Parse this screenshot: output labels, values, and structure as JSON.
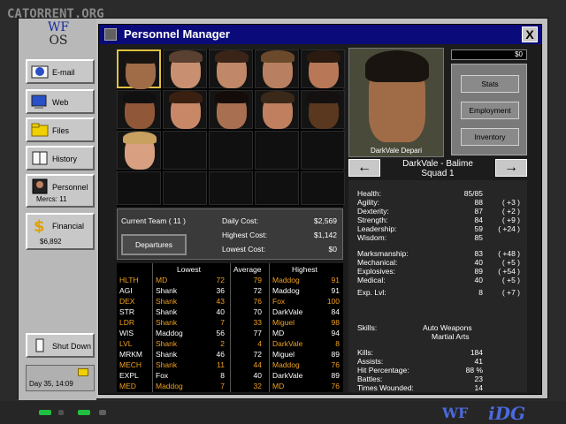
{
  "watermark": "CATORRENT.ORG",
  "os": {
    "logo_wf": "WF",
    "logo_os": "OS",
    "buttons": {
      "email": "E-mail",
      "web": "Web",
      "files": "Files",
      "history": "History",
      "personnel": "Personnel",
      "personnel_sub": "Mercs: 11",
      "financial": "Financial",
      "financial_sub": "$6,892",
      "shutdown": "Shut Down"
    },
    "date": "Day 35, 14:09"
  },
  "window": {
    "title": "Personnel Manager",
    "close": "X"
  },
  "team": {
    "current_team": "Current Team  ( 11 )",
    "daily_cost_label": "Daily Cost:",
    "daily_cost": "$2,569",
    "highest_cost_label": "Highest Cost:",
    "highest_cost": "$1,142",
    "lowest_cost_label": "Lowest Cost:",
    "lowest_cost": "$0",
    "departures": "Departures"
  },
  "stats_table": {
    "headers": {
      "lowest": "Lowest",
      "average": "Average",
      "highest": "Highest"
    },
    "rows": [
      {
        "stat": "HLTH",
        "low_name": "MD",
        "low": "72",
        "avg": "79",
        "high_name": "Maddog",
        "high": "91",
        "highlight": true
      },
      {
        "stat": "AGI",
        "low_name": "Shank",
        "low": "36",
        "avg": "72",
        "high_name": "Maddog",
        "high": "91",
        "highlight": false
      },
      {
        "stat": "DEX",
        "low_name": "Shank",
        "low": "43",
        "avg": "76",
        "high_name": "Fox",
        "high": "100",
        "highlight": true
      },
      {
        "stat": "STR",
        "low_name": "Shank",
        "low": "40",
        "avg": "70",
        "high_name": "DarkVale",
        "high": "84",
        "highlight": false
      },
      {
        "stat": "LDR",
        "low_name": "Shank",
        "low": "7",
        "avg": "33",
        "high_name": "Miguel",
        "high": "98",
        "highlight": true
      },
      {
        "stat": "WIS",
        "low_name": "Maddog",
        "low": "56",
        "avg": "77",
        "high_name": "MD",
        "high": "94",
        "highlight": false
      },
      {
        "stat": "LVL",
        "low_name": "Shank",
        "low": "2",
        "avg": "4",
        "high_name": "DarkVale",
        "high": "8",
        "highlight": true
      },
      {
        "stat": "MRKM",
        "low_name": "Shank",
        "low": "46",
        "avg": "72",
        "high_name": "Miguel",
        "high": "89",
        "highlight": false
      },
      {
        "stat": "MECH",
        "low_name": "Shank",
        "low": "11",
        "avg": "44",
        "high_name": "Maddog",
        "high": "76",
        "highlight": true
      },
      {
        "stat": "EXPL",
        "low_name": "Fox",
        "low": "8",
        "avg": "40",
        "high_name": "DarkVale",
        "high": "89",
        "highlight": false
      },
      {
        "stat": "MED",
        "low_name": "Maddog",
        "low": "7",
        "avg": "32",
        "high_name": "MD",
        "high": "76",
        "highlight": true
      }
    ]
  },
  "merc": {
    "portrait_caption": "DarkVale Depari",
    "title": "DarkVale - Balime",
    "squad": "Squad 1",
    "cash": "$0",
    "actions": {
      "stats": "Stats",
      "employment": "Employment",
      "inventory": "Inventory"
    },
    "nav_left": "←",
    "nav_right": "→",
    "stats": [
      {
        "k": "Health:",
        "v": "85/85",
        "b": ""
      },
      {
        "k": "Agility:",
        "v": "88",
        "b": "( +3 )"
      },
      {
        "k": "Dexterity:",
        "v": "87",
        "b": "( +2 )"
      },
      {
        "k": "Strength:",
        "v": "84",
        "b": "( +9 )"
      },
      {
        "k": "Leadership:",
        "v": "59",
        "b": "( +24 )"
      },
      {
        "k": "Wisdom:",
        "v": "85",
        "b": ""
      },
      {
        "k": "Marksmanship:",
        "v": "83",
        "b": "( +48 )"
      },
      {
        "k": "Mechanical:",
        "v": "40",
        "b": "( +5 )"
      },
      {
        "k": "Explosives:",
        "v": "89",
        "b": "( +54 )"
      },
      {
        "k": "Medical:",
        "v": "40",
        "b": "( +5 )"
      },
      {
        "k": "Exp. Lvl:",
        "v": "8",
        "b": "( +7 )"
      }
    ],
    "skills_label": "Skills:",
    "skill1": "Auto Weapons",
    "skill2": "Martial Arts",
    "records": [
      {
        "k": "Kills:",
        "v": "184"
      },
      {
        "k": "Assists:",
        "v": "41"
      },
      {
        "k": "Hit Percentage:",
        "v": "88 %"
      },
      {
        "k": "Battles:",
        "v": "23"
      },
      {
        "k": "Times Wounded:",
        "v": "14"
      }
    ]
  },
  "taskbar": {
    "logo_wf": "WF",
    "logo_idg": "iDG"
  },
  "colors": {
    "title_bar": "#0a0a7a",
    "highlight_text": "#f0a020",
    "window_bg": "#1c1c1c"
  }
}
